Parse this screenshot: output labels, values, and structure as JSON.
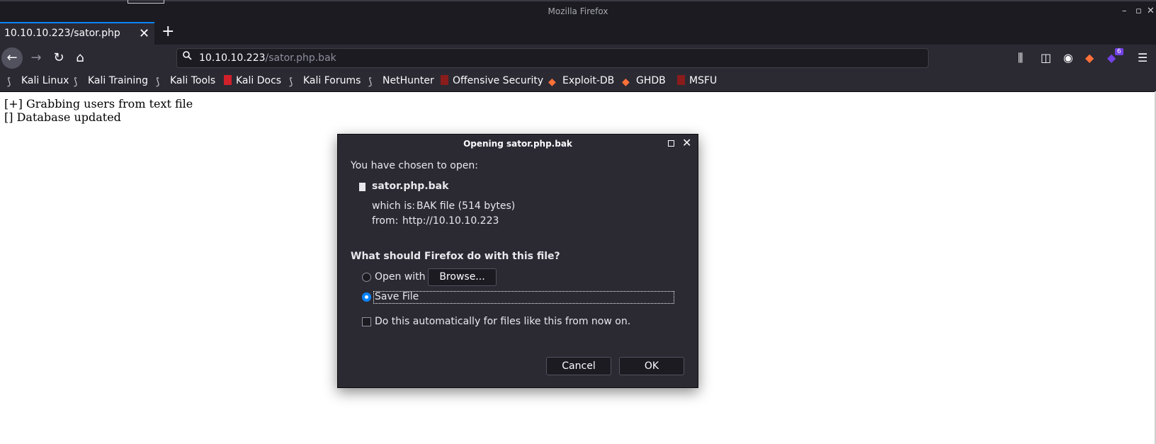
{
  "window": {
    "title": "Mozilla Firefox",
    "controls": [
      "minimize-icon",
      "maximize-icon",
      "close-icon"
    ]
  },
  "tab": {
    "title": "10.10.10.223/sator.php",
    "close": "✕",
    "new_tab": "+"
  },
  "url": {
    "host": "10.10.10.223",
    "path": "/sator.php.bak"
  },
  "bookmarks": [
    {
      "label": "Kali Linux",
      "icon": "kali-dragon-icon"
    },
    {
      "label": "Kali Training",
      "icon": "kali-dragon-icon"
    },
    {
      "label": "Kali Tools",
      "icon": "kali-dragon-icon"
    },
    {
      "label": "Kali Docs",
      "icon": "kali-docs-icon"
    },
    {
      "label": "Kali Forums",
      "icon": "kali-dragon-icon"
    },
    {
      "label": "NetHunter",
      "icon": "kali-dragon-icon"
    },
    {
      "label": "Offensive Security",
      "icon": "offsec-icon"
    },
    {
      "label": "Exploit-DB",
      "icon": "exploitdb-icon"
    },
    {
      "label": "GHDB",
      "icon": "exploitdb-icon"
    },
    {
      "label": "MSFU",
      "icon": "offsec-icon"
    }
  ],
  "toolbar": {
    "badge_count": "6"
  },
  "page": {
    "lines": [
      "[+] Grabbing users from text file",
      "[] Database updated"
    ]
  },
  "dialog": {
    "title": "Opening sator.php.bak",
    "intro": "You have chosen to open:",
    "filename": "sator.php.bak",
    "which_is_label": "which is:",
    "which_is_value": "BAK file (514 bytes)",
    "from_label": "from:",
    "from_value": "http://10.10.10.223",
    "question": "What should Firefox do with this file?",
    "open_with_label": "Open with",
    "browse_button": "Browse...",
    "save_file_label": "Save File",
    "selected_option": "Save File",
    "auto_checkbox_label": "Do this automatically for files like this from now on.",
    "auto_checked": false,
    "cancel_button": "Cancel",
    "ok_button": "OK"
  },
  "colors": {
    "chrome_dark": "#1c1b22",
    "chrome": "#2b2a33",
    "accent": "#0a84ff",
    "badge": "#7542e5"
  }
}
